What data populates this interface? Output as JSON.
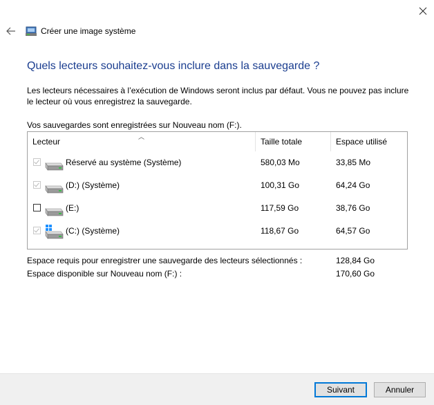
{
  "window": {
    "title": "Créer une image système",
    "close_icon": "close-icon",
    "back_icon": "back-arrow-icon"
  },
  "heading": "Quels lecteurs souhaitez-vous inclure dans la sauvegarde ?",
  "description": "Les lecteurs nécessaires à l’exécution de Windows seront inclus par défaut. Vous ne pouvez pas inclure le lecteur où vous enregistrez la sauvegarde.",
  "saved_on": "Vos sauvegardes sont enregistrées sur Nouveau nom (F:).",
  "table": {
    "headers": [
      "Lecteur",
      "Taille totale",
      "Espace utilisé"
    ],
    "rows": [
      {
        "name": "Réservé au système (Système)",
        "size": "580,03 Mo",
        "used": "33,85 Mo",
        "checked": true,
        "enabled": false,
        "icon": "drive-icon"
      },
      {
        "name": "(D:) (Système)",
        "size": "100,31 Go",
        "used": "64,24 Go",
        "checked": true,
        "enabled": false,
        "icon": "drive-icon"
      },
      {
        "name": "(E:)",
        "size": "117,59 Go",
        "used": "38,76 Go",
        "checked": false,
        "enabled": true,
        "icon": "drive-icon"
      },
      {
        "name": "(C:) (Système)",
        "size": "118,67 Go",
        "used": "64,57 Go",
        "checked": true,
        "enabled": false,
        "icon": "windows-drive-icon"
      }
    ]
  },
  "summary": {
    "required_label": "Espace requis pour enregistrer une sauvegarde des lecteurs sélectionnés :",
    "required_value": "128,84 Go",
    "available_label": "Espace disponible sur Nouveau nom (F:) :",
    "available_value": "170,60 Go"
  },
  "buttons": {
    "next": "Suivant",
    "cancel": "Annuler"
  },
  "colors": {
    "heading": "#1a3d8f",
    "primary_border": "#0078d7"
  }
}
